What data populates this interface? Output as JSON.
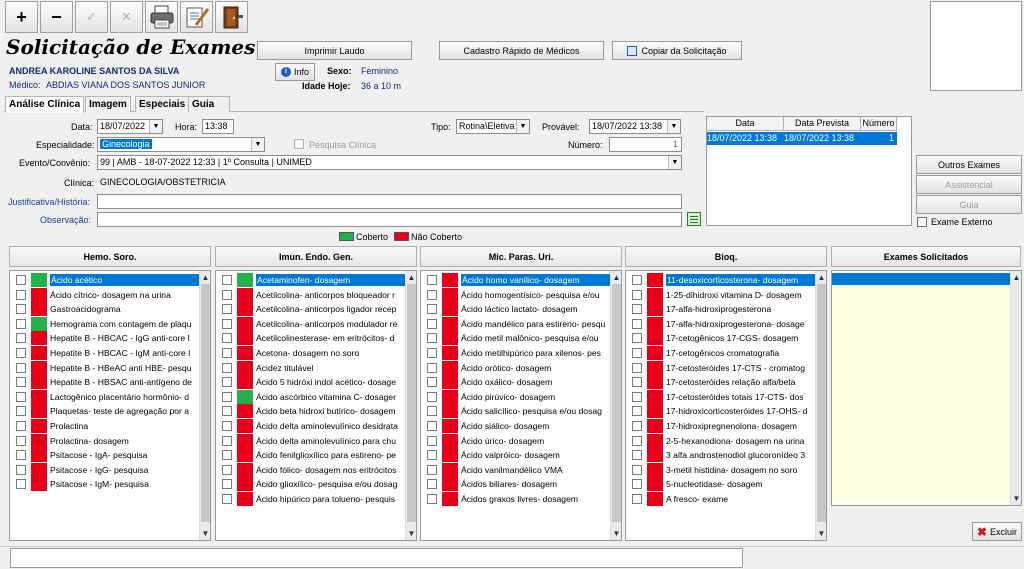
{
  "toolbar": {
    "add_label": "+",
    "remove_label": "−",
    "confirm_label": "✓",
    "cancel_label": "✕"
  },
  "header": {
    "title": "Solicitação de Exames",
    "patient_name": "ANDREA KAROLINE SANTOS DA SILVA",
    "doctor_label": "Médico:",
    "doctor_name": "ABDIAS VIANA DOS SANTOS JUNIOR",
    "info_label": "Info",
    "sex_label": "Sexo:",
    "sex_value": "Feminino",
    "age_label": "Idade Hoje:",
    "age_value": "36 a 10 m"
  },
  "buttons": {
    "print": "Imprimir Laudo",
    "quick_register": "Cadastro Rápido de Médicos",
    "copy": "Copiar da Solicitação",
    "other_exams": "Outros Exames",
    "assistance": "Assistencial",
    "guide": "Guia",
    "external": "Exame Externo",
    "delete": "Excluir"
  },
  "tabs": [
    "Análise Clínica",
    "Imagem",
    "Especiais",
    "Guia"
  ],
  "form": {
    "date_label": "Data:",
    "date_value": "18/07/2022",
    "hour_label": "Hora:",
    "hour_value": "13:38",
    "type_label": "Tipo:",
    "type_value": "Rotina\\Eletiva",
    "probable_label": "Provável:",
    "probable_value": "18/07/2022 13:38",
    "specialty_label": "Especialidade:",
    "specialty_value": "Ginecologia",
    "clinical_search_label": "Pesquisa Clínica",
    "number_label": "Número:",
    "number_value": "1",
    "event_label": "Evento/Convênio:",
    "event_value": "99 | AMB - 18-07-2022 12:33 | 1º Consulta | UNIMED",
    "clinic_label": "Clínica:",
    "clinic_value": "GINECOLOGIA/OBSTETRICIA",
    "justification_label": "Justificativa/História:",
    "observation_label": "Observação:"
  },
  "grid": {
    "headers": [
      "Data",
      "Data Prevista",
      "Número"
    ],
    "row": [
      "18/07/2022 13:38",
      "18/07/2022 13:38",
      "1"
    ]
  },
  "legend": {
    "covered": "Coberto",
    "not_covered": "Não Coberto",
    "covered_color": "#21b24b",
    "not_covered_color": "#e8001a"
  },
  "panels": [
    {
      "title": "Hemo. Soro.",
      "items": [
        {
          "label": "Ácido acético",
          "covered": true
        },
        {
          "label": "Ácido cítrico- dosagem na urina",
          "covered": false
        },
        {
          "label": "Gastroacidograma",
          "covered": false
        },
        {
          "label": "Hemograma com contagem de plaqu",
          "covered": true
        },
        {
          "label": "Hepatite B - HBCAC - IgG anti-core I",
          "covered": false
        },
        {
          "label": "Hepatite B - HBCAC - IgM anti-core I",
          "covered": false
        },
        {
          "label": "Hepatite B - HBeAC anti HBE- pesqu",
          "covered": false
        },
        {
          "label": "Hepatite B - HBSAC anti-antígeno de",
          "covered": false
        },
        {
          "label": "Lactogênico placentário hormônio- d",
          "covered": false
        },
        {
          "label": "Plaquetas- teste de agregação por a",
          "covered": false
        },
        {
          "label": "Prolactina",
          "covered": false
        },
        {
          "label": "Prolactina- dosagem",
          "covered": false
        },
        {
          "label": "Psitacose - IgA- pesquisa",
          "covered": false
        },
        {
          "label": "Psitacose - IgG- pesquisa",
          "covered": false
        },
        {
          "label": "Psitacose - IgM- pesquisa",
          "covered": false
        }
      ]
    },
    {
      "title": "Imun. Endo. Gen.",
      "items": [
        {
          "label": "Acetaminofen- dosagem",
          "covered": true
        },
        {
          "label": "Acetilcolina- anticorpos bloqueador r",
          "covered": false
        },
        {
          "label": "Acetilcolina- anticorpos ligador recep",
          "covered": false
        },
        {
          "label": "Acetilcolina- anticorpos modulador re",
          "covered": false
        },
        {
          "label": "Acetilcolinesterase- em eritrócitos- d",
          "covered": false
        },
        {
          "label": "Acetona- dosagem no soro",
          "covered": false
        },
        {
          "label": "Acidez titulável",
          "covered": false
        },
        {
          "label": "Ácido 5 hidróxi indol acético- dosage",
          "covered": false
        },
        {
          "label": "Ácido ascórbico vitamina C- dosager",
          "covered": true
        },
        {
          "label": "Ácido beta hidroxi butírico- dosagem",
          "covered": false
        },
        {
          "label": "Ácido delta aminolevulínico desidrata",
          "covered": false
        },
        {
          "label": "Ácido delta aminolevulínico para chu",
          "covered": false
        },
        {
          "label": "Ácido fenilglioxílico para estireno- pe",
          "covered": false
        },
        {
          "label": "Ácido fólico- dosagem nos eritrócitos",
          "covered": false
        },
        {
          "label": "Ácido glioxílico- pesquisa e/ou dosag",
          "covered": false
        },
        {
          "label": "Ácido hipúrico para tolueno- pesquis",
          "covered": false
        }
      ]
    },
    {
      "title": "Mic. Paras. Uri.",
      "items": [
        {
          "label": "Ácido homo vanílico- dosagem",
          "covered": false
        },
        {
          "label": "Ácido homogentísico- pesquisa e/ou",
          "covered": false
        },
        {
          "label": "Ácido láctico lactato- dosagem",
          "covered": false
        },
        {
          "label": "Ácido mandélico para estireno- pesqu",
          "covered": false
        },
        {
          "label": "Ácido metil malônico- pesquisa e/ou",
          "covered": false
        },
        {
          "label": "Ácido metilhipúrico para xilenos- pes",
          "covered": false
        },
        {
          "label": "Ácido orótico- dosagem",
          "covered": false
        },
        {
          "label": "Ácido oxálico- dosagem",
          "covered": false
        },
        {
          "label": "Ácido pirúvico- dosagem",
          "covered": false
        },
        {
          "label": "Ácido salicílico- pesquisa e/ou dosag",
          "covered": false
        },
        {
          "label": "Ácido siálico- dosagem",
          "covered": false
        },
        {
          "label": "Ácido úrico- dosagem",
          "covered": false
        },
        {
          "label": "Ácido valpróico- dosagem",
          "covered": false
        },
        {
          "label": "Ácido vanilmandélico VMA",
          "covered": false
        },
        {
          "label": "Ácidos biliares- dosagem",
          "covered": false
        },
        {
          "label": "Ácidos graxos livres- dosagem",
          "covered": false
        }
      ]
    },
    {
      "title": "Bioq.",
      "items": [
        {
          "label": "11-desoxicorticosterona- dosagem",
          "covered": false
        },
        {
          "label": "1-25-dihidroxi vitamina D- dosagem",
          "covered": false
        },
        {
          "label": "17-alfa-hidroxiprogesterona",
          "covered": false
        },
        {
          "label": "17-alfa-hidroxiprogesterona- dosage",
          "covered": false
        },
        {
          "label": "17-cetogênicos 17-CGS- dosagem",
          "covered": false
        },
        {
          "label": "17-cetogênicos cromatografia",
          "covered": false
        },
        {
          "label": "17-cetosteróides 17-CTS - cromatog",
          "covered": false
        },
        {
          "label": "17-cetosteróides relação alfa/beta",
          "covered": false
        },
        {
          "label": "17-cetosteróides totais 17-CTS- dos",
          "covered": false
        },
        {
          "label": "17-hidroxicorticosteróides 17-OHS- d",
          "covered": false
        },
        {
          "label": "17-hidroxipregnenolona- dosagem",
          "covered": false
        },
        {
          "label": "2-5-hexanodiona- dosagem na urina",
          "covered": false
        },
        {
          "label": "3 alfa androstenodiol glucoronídeo 3",
          "covered": false
        },
        {
          "label": "3-metil histidina- dosagem no soro",
          "covered": false
        },
        {
          "label": "5-nucleotidase- dosagem",
          "covered": false
        },
        {
          "label": "A fresco- exame",
          "covered": false
        }
      ]
    }
  ],
  "requested": {
    "title": "Exames Solicitados"
  }
}
